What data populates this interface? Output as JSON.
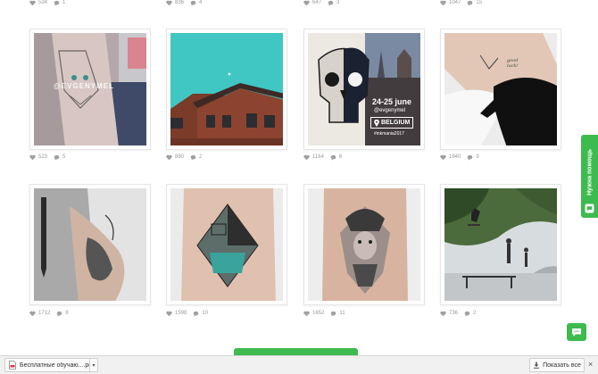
{
  "colors": {
    "accent": "#3dbb4f",
    "stat_icon": "#a0a0a0"
  },
  "top_stats": [
    {
      "likes": "534",
      "comments": "1"
    },
    {
      "likes": "836",
      "comments": "4"
    },
    {
      "likes": "647",
      "comments": "3"
    },
    {
      "likes": "1047",
      "comments": "15"
    }
  ],
  "posts": [
    {
      "likes": "523",
      "comments": "5",
      "watermark": "@EVGENYMEL"
    },
    {
      "likes": "880",
      "comments": "2"
    },
    {
      "likes": "1164",
      "comments": "6",
      "overlay": {
        "dates": "24-25 june",
        "handle": "@evgenymel",
        "country": "BELGIUM",
        "hashtag": "#inkmania2017"
      }
    },
    {
      "likes": "1940",
      "comments": "9",
      "tattoo_text": "good luck!"
    },
    {
      "likes": "1712",
      "comments": "8"
    },
    {
      "likes": "1598",
      "comments": "10"
    },
    {
      "likes": "1652",
      "comments": "11"
    },
    {
      "likes": "736",
      "comments": "2"
    }
  ],
  "help_tab": {
    "label": "Нужна помощь",
    "icon": "chat-bubble"
  },
  "chat_button": {
    "icon": "chat-bubble"
  },
  "download_bar": {
    "file_name": "Бесплатные обучаю....pdf",
    "file_icon": "pdf-file",
    "show_all_label": "Показать все",
    "show_all_icon": "download-arrow",
    "close_glyph": "×"
  }
}
